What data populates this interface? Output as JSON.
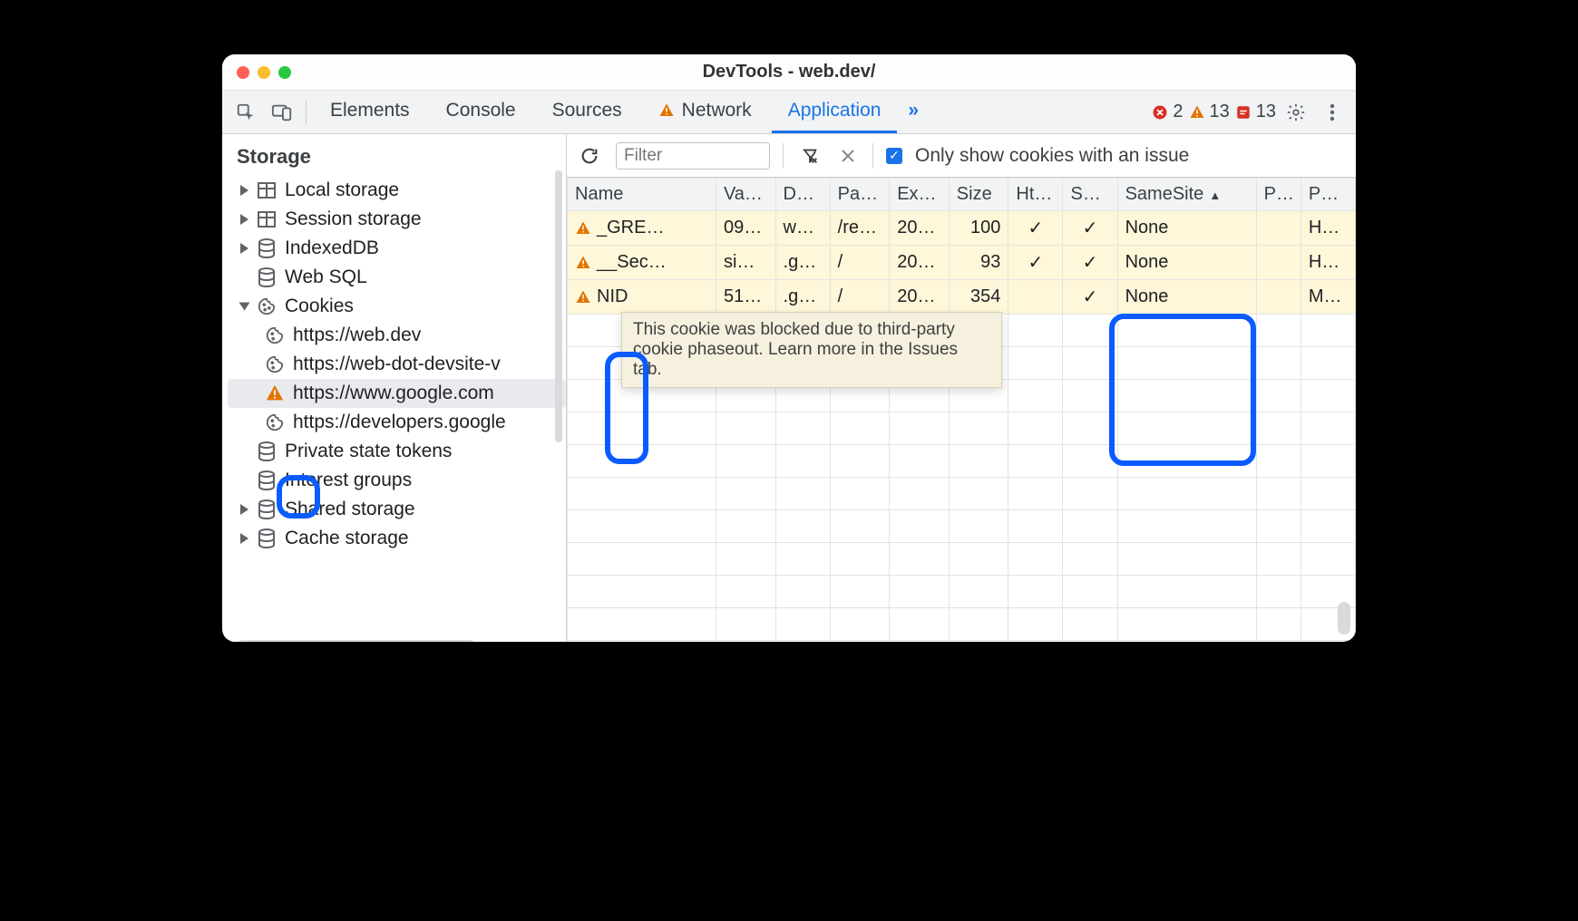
{
  "window": {
    "title": "DevTools - web.dev/"
  },
  "tabs": {
    "elements": "Elements",
    "console": "Console",
    "sources": "Sources",
    "network": "Network",
    "application": "Application",
    "more": "»"
  },
  "counts": {
    "errors": "2",
    "warnings": "13",
    "issues": "13"
  },
  "sidebar": {
    "heading": "Storage",
    "items": {
      "local": "Local storage",
      "session": "Session storage",
      "idb": "IndexedDB",
      "websql": "Web SQL",
      "cookies": "Cookies",
      "cookie_a": "https://web.dev",
      "cookie_b": "https://web-dot-devsite-v",
      "cookie_c": "https://www.google.com",
      "cookie_d": "https://developers.google",
      "pst": "Private state tokens",
      "ig": "Interest groups",
      "shared": "Shared storage",
      "cache": "Cache storage"
    }
  },
  "toolbar": {
    "filter_placeholder": "Filter",
    "only_issues": "Only show cookies with an issue"
  },
  "table": {
    "headers": {
      "name": "Name",
      "value": "Va…",
      "domain": "D…",
      "path": "Pa…",
      "expires": "Ex…",
      "size": "Size",
      "http": "Ht…",
      "secure": "Se…",
      "samesite": "SameSite",
      "partition": "P…",
      "priority": "P…"
    },
    "rows": [
      {
        "name": "_GRE…",
        "value": "09…",
        "domain": "w…",
        "path": "/re…",
        "expires": "20…",
        "size": "100",
        "http": "✓",
        "secure": "✓",
        "samesite": "None",
        "partition": "",
        "priority": "H…"
      },
      {
        "name": "__Sec…",
        "value": "si…",
        "domain": ".g…",
        "path": "/",
        "expires": "20…",
        "size": "93",
        "http": "✓",
        "secure": "✓",
        "samesite": "None",
        "partition": "",
        "priority": "H…"
      },
      {
        "name": "NID",
        "value": "51…",
        "domain": ".g…",
        "path": "/",
        "expires": "20…",
        "size": "354",
        "http": "",
        "secure": "✓",
        "samesite": "None",
        "partition": "",
        "priority": "M…"
      }
    ]
  },
  "tooltip": "This cookie was blocked due to third-party cookie phaseout. Learn more in the Issues tab."
}
